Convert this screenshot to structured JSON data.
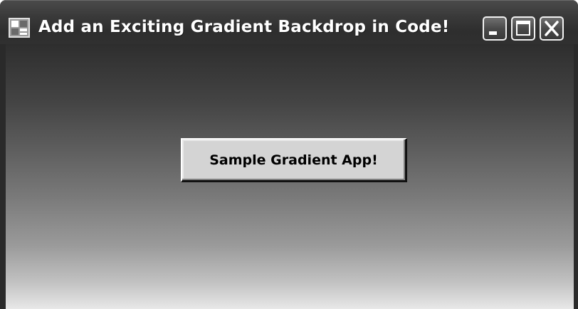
{
  "window": {
    "title": "Add an Exciting Gradient Backdrop in Code!",
    "icon": "application-form-icon",
    "controls": {
      "minimize_icon": "minimize-icon",
      "maximize_icon": "maximize-icon",
      "close_icon": "close-icon"
    }
  },
  "content": {
    "button_label": "Sample Gradient App!",
    "backdrop_gradient": {
      "direction": "top-to-bottom",
      "from_color": "#2e2e2e",
      "to_color": "#e8e8e8"
    }
  }
}
